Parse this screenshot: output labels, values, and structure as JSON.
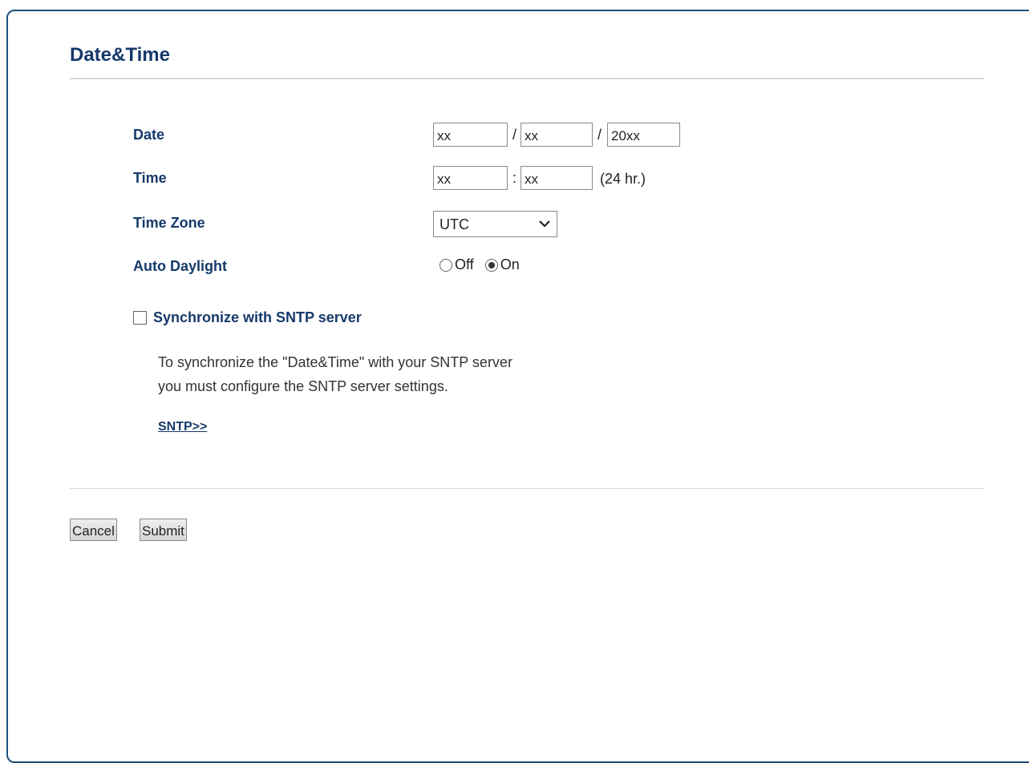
{
  "page": {
    "title": "Date&Time"
  },
  "form": {
    "date": {
      "label": "Date",
      "month": "xx",
      "day": "xx",
      "year": "20xx",
      "separator": "/"
    },
    "time": {
      "label": "Time",
      "hour": "xx",
      "minute": "xx",
      "separator": ":",
      "suffix": "(24 hr.)"
    },
    "time_zone": {
      "label": "Time Zone",
      "selected": "UTC"
    },
    "auto_daylight": {
      "label": "Auto Daylight",
      "off_label": "Off",
      "on_label": "On",
      "selected": "On"
    },
    "sntp": {
      "checkbox_label": "Synchronize with SNTP server",
      "checked": false,
      "note_line1": "To synchronize the \"Date&Time\" with your SNTP server",
      "note_line2": "you must configure the SNTP server settings.",
      "link_label": "SNTP>>"
    }
  },
  "buttons": {
    "cancel": "Cancel",
    "submit": "Submit"
  },
  "colors": {
    "heading": "#163a6b",
    "frame": "#1f4f7a"
  }
}
